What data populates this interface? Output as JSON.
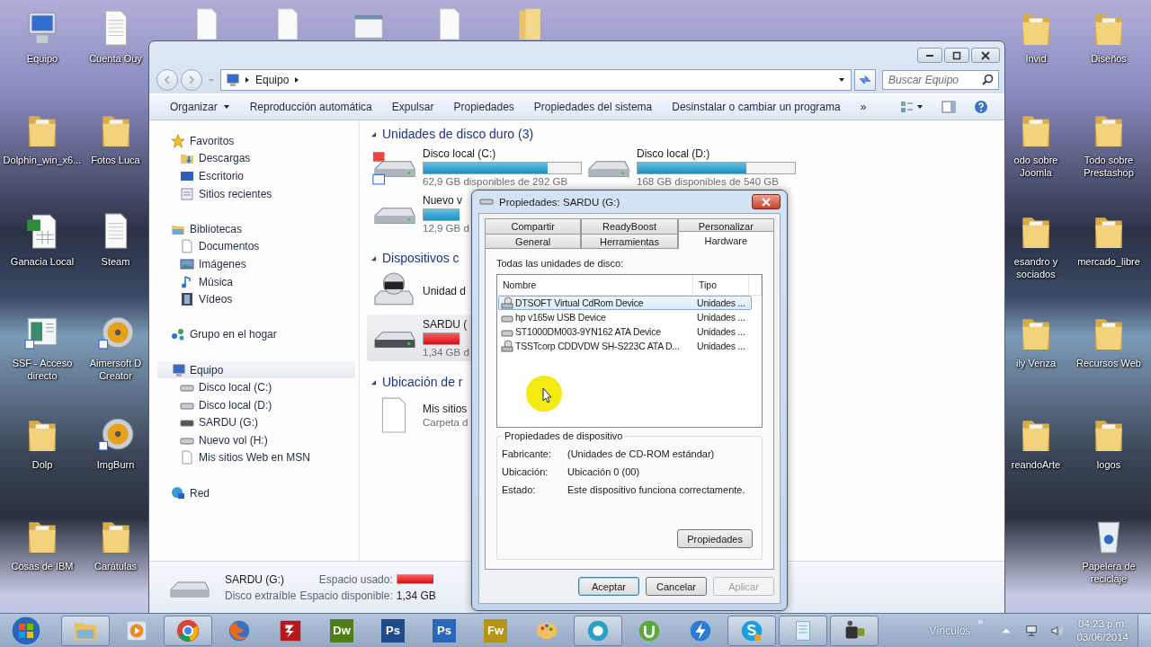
{
  "desktop": {
    "partially_hidden_icons": [
      {
        "kind": "file"
      },
      {
        "kind": "file"
      },
      {
        "kind": "app"
      },
      {
        "kind": "file"
      },
      {
        "kind": "folder"
      }
    ],
    "columns": [
      [
        {
          "label": "Equipo",
          "kind": "computer"
        },
        {
          "label": "Dolphin_win_x6...",
          "kind": "folder"
        },
        {
          "label": "Ganacia Local",
          "kind": "excel"
        },
        {
          "label": "SSF - Acceso directo",
          "kind": "app"
        },
        {
          "label": "Dolp",
          "kind": "folder"
        },
        {
          "label": "Cosas de IBM",
          "kind": "folder"
        }
      ],
      [
        {
          "label": "Cuenta Ouy",
          "kind": "file"
        },
        {
          "label": "Fotos Luca",
          "kind": "folder"
        },
        {
          "label": "Steam",
          "kind": "file"
        },
        {
          "label": "Aimersoft D Creator",
          "kind": "disc"
        },
        {
          "label": "ImgBurn",
          "kind": "disc"
        },
        {
          "label": "Carátulas",
          "kind": "folder"
        }
      ],
      [
        {
          "label": "Invid",
          "kind": "folder"
        },
        {
          "label": "odo sobre Joomla",
          "kind": "folder"
        },
        {
          "label": "esandro y sociados",
          "kind": "folder"
        },
        {
          "label": "ily Venza",
          "kind": "folder"
        },
        {
          "label": "reandoArte",
          "kind": "folder"
        }
      ],
      [
        {
          "label": "Diseños",
          "kind": "folder"
        },
        {
          "label": "Todo sobre Prestashop",
          "kind": "folder"
        },
        {
          "label": "mercado_libre",
          "kind": "folder"
        },
        {
          "label": "Recursos Web",
          "kind": "folder"
        },
        {
          "label": "logos",
          "kind": "folder"
        },
        {
          "label": "Papelera de reciclaje",
          "kind": "recycle"
        }
      ]
    ]
  },
  "explorer": {
    "address": {
      "crumbs": [
        "Equipo"
      ]
    },
    "search": {
      "placeholder": "Buscar Equipo"
    },
    "toolbar": [
      {
        "label": "Organizar",
        "kind": "menu"
      },
      {
        "label": "Reproducción automática",
        "kind": "command"
      },
      {
        "label": "Expulsar",
        "kind": "command"
      },
      {
        "label": "Propiedades",
        "kind": "command"
      },
      {
        "label": "Propiedades del sistema",
        "kind": "command"
      },
      {
        "label": "Desinstalar o cambiar un programa",
        "kind": "command"
      },
      {
        "label": "»",
        "kind": "command"
      }
    ],
    "nav": [
      {
        "label": "Favoritos",
        "kind": "star",
        "selected": false,
        "children": [
          {
            "label": "Descargas",
            "kind": "downloads",
            "selected": false
          },
          {
            "label": "Escritorio",
            "kind": "desktop",
            "selected": false
          },
          {
            "label": "Sitios recientes",
            "kind": "recent",
            "selected": false
          }
        ]
      },
      {
        "label": "Bibliotecas",
        "kind": "library",
        "selected": false,
        "children": [
          {
            "label": "Documentos",
            "kind": "documents",
            "selected": false
          },
          {
            "label": "Imágenes",
            "kind": "pictures",
            "selected": false
          },
          {
            "label": "Música",
            "kind": "music",
            "selected": false
          },
          {
            "label": "Vídeos",
            "kind": "videos",
            "selected": false
          }
        ]
      },
      {
        "label": "Grupo en el hogar",
        "kind": "homegroup",
        "selected": false
      },
      {
        "label": "Equipo",
        "kind": "computer",
        "selected": true,
        "children": [
          {
            "label": "Disco local (C:)",
            "kind": "hdd",
            "selected": false
          },
          {
            "label": "Disco local (D:)",
            "kind": "hdd",
            "selected": false
          },
          {
            "label": "SARDU (G:)",
            "kind": "usb",
            "selected": false
          },
          {
            "label": "Nuevo vol (H:)",
            "kind": "hdd",
            "selected": false
          },
          {
            "label": "Mis sitios Web en MSN",
            "kind": "page",
            "selected": false
          }
        ]
      },
      {
        "label": "Red",
        "kind": "network",
        "selected": false
      }
    ],
    "groups": [
      {
        "title": "Unidades de disco duro (3)",
        "items": [
          {
            "name": "Disco local (C:)",
            "kind": "hdd-win",
            "selected": false,
            "level": 0.79,
            "critical": false,
            "detail": "62,9 GB disponibles de 292 GB"
          },
          {
            "name": "Disco local (D:)",
            "kind": "hdd",
            "selected": false,
            "level": 0.69,
            "critical": false,
            "detail": "168 GB disponibles de 540 GB"
          },
          {
            "name": "Nuevo v",
            "kind": "hdd",
            "selected": false,
            "critical": false,
            "detail": "12,9 GB d"
          }
        ]
      },
      {
        "title": "Dispositivos c",
        "items": [
          {
            "name": "Unidad d",
            "kind": "dvd",
            "selected": false
          },
          {
            "name": "SARDU (",
            "kind": "usb",
            "selected": true,
            "critical": true,
            "detail": "1,34 GB d"
          }
        ]
      },
      {
        "title": "Ubicación de r",
        "items": [
          {
            "name": "Mis sitios",
            "kind": "file",
            "selected": false,
            "detail": "Carpeta d"
          }
        ]
      }
    ],
    "details": {
      "name": "SARDU (G:)",
      "type": "Disco extraíble",
      "used_label": "Espacio usado:",
      "free_label": "Espacio disponible:",
      "free": "1,34 GB",
      "critical": true
    }
  },
  "dialog": {
    "title": "Propiedades: SARDU (G:)",
    "tab_rows": [
      [
        {
          "label": "Compartir",
          "selected": false
        },
        {
          "label": "ReadyBoost",
          "selected": false
        },
        {
          "label": "Personalizar",
          "selected": false
        }
      ],
      [
        {
          "label": "General",
          "selected": false
        },
        {
          "label": "Herramientas",
          "selected": false
        },
        {
          "label": "Hardware",
          "selected": true
        }
      ]
    ],
    "list_label": "Todas las unidades de disco:",
    "columns": [
      "Nombre",
      "Tipo"
    ],
    "devices": [
      {
        "name": "DTSOFT Virtual CdRom Device",
        "type": "Unidades ...",
        "kind": "cdrom",
        "selected": true
      },
      {
        "name": "hp v165w USB Device",
        "type": "Unidades ...",
        "kind": "disk",
        "selected": false
      },
      {
        "name": "ST1000DM003-9YN162 ATA Device",
        "type": "Unidades ...",
        "kind": "disk",
        "selected": false
      },
      {
        "name": "TSSTcorp CDDVDW SH-S223C ATA D...",
        "type": "Unidades ...",
        "kind": "cdrom",
        "selected": false
      }
    ],
    "group_title": "Propiedades de dispositivo",
    "fields": [
      {
        "label": "Fabricante:",
        "value": "(Unidades de CD-ROM estándar)"
      },
      {
        "label": "Ubicación:",
        "value": "Ubicación 0 (00)"
      },
      {
        "label": "Estado:",
        "value": "Este dispositivo funciona correctamente."
      }
    ],
    "properties_button": "Propiedades",
    "buttons": [
      {
        "label": "Aceptar",
        "kind": "default",
        "disabled": false
      },
      {
        "label": "Cancelar",
        "kind": "normal",
        "disabled": false
      },
      {
        "label": "Aplicar",
        "kind": "normal",
        "disabled": true
      }
    ]
  },
  "taskbar": {
    "apps": [
      {
        "kind": "explorer",
        "running": true
      },
      {
        "kind": "media",
        "running": false
      },
      {
        "kind": "chrome",
        "running": true
      },
      {
        "kind": "firefox",
        "running": false
      },
      {
        "kind": "filezilla",
        "running": false
      },
      {
        "kind": "tile",
        "label": "Dw",
        "color": "#4f7d1a",
        "running": false
      },
      {
        "kind": "tile",
        "label": "Ps",
        "color": "#1f4a8c",
        "running": false
      },
      {
        "kind": "tile",
        "label": "Ps",
        "color": "#2a67b8",
        "running": false
      },
      {
        "kind": "tile",
        "label": "Fw",
        "color": "#b59418",
        "running": false
      },
      {
        "kind": "palette",
        "running": false
      },
      {
        "kind": "bs",
        "running": true
      },
      {
        "kind": "utorrent",
        "running": false
      },
      {
        "kind": "lightning",
        "running": false
      },
      {
        "kind": "skype",
        "running": true
      },
      {
        "kind": "notepad",
        "running": true
      },
      {
        "kind": "camcorder",
        "running": true
      }
    ],
    "links_label": "Vínculos",
    "links_more": "»",
    "time": "04:23 p.m.",
    "date": "03/06/2014"
  }
}
